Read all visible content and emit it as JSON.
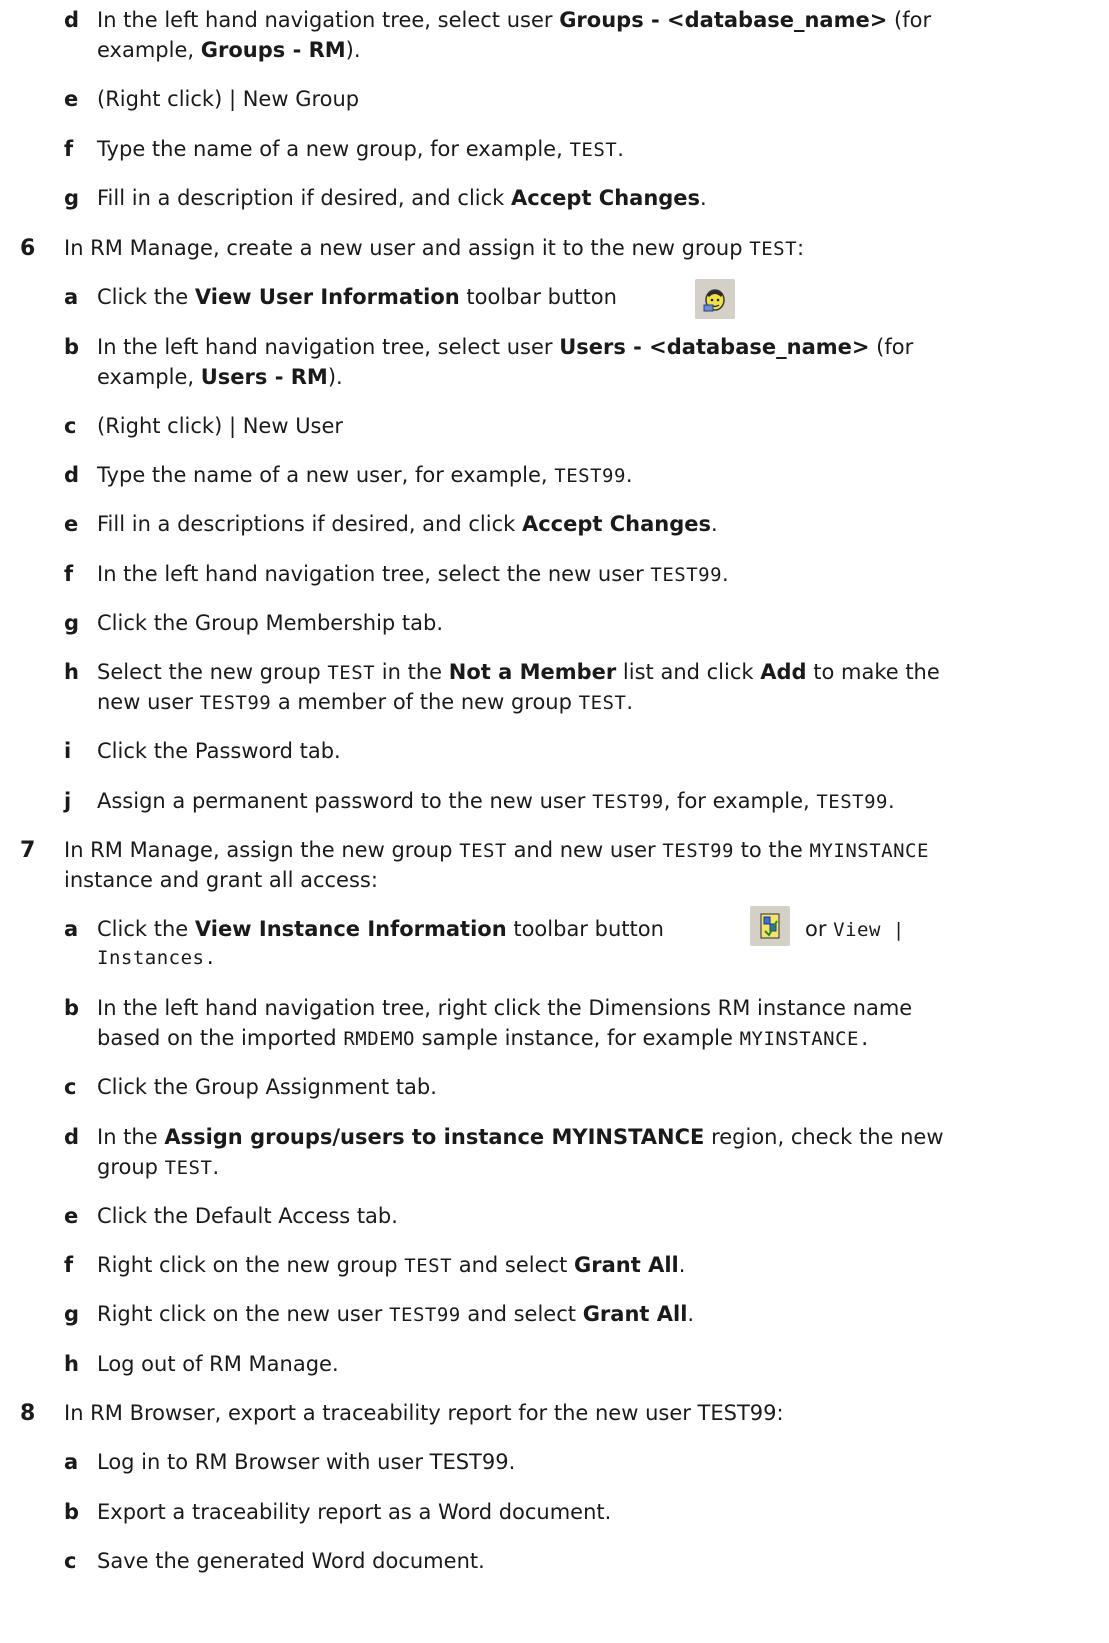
{
  "steps": {
    "s5": {
      "items": {
        "d": {
          "letter": "d",
          "l1_a": "In the left hand navigation tree, select user ",
          "l1_b": "Groups - <database_name>",
          "l1_c": " (for",
          "l2_a": "example, ",
          "l2_b": "Groups - RM",
          "l2_c": ")."
        },
        "e": {
          "letter": "e",
          "text": "(Right click) | New Group"
        },
        "f": {
          "letter": "f",
          "a": "Type the name of a new group, for example, ",
          "code": "TEST",
          "c": "."
        },
        "g": {
          "letter": "g",
          "a": "Fill in a description if desired, and click ",
          "b": "Accept Changes",
          "c": "."
        }
      }
    },
    "s6": {
      "num": "6",
      "a": "In RM Manage, create a new user and assign it to the new group ",
      "code": "TEST",
      "c": ":",
      "items": {
        "a": {
          "letter": "a",
          "t1": "Click the ",
          "b": "View User Information",
          "t2": " toolbar button"
        },
        "b": {
          "letter": "b",
          "l1_a": "In the left hand navigation tree, select user ",
          "l1_b": "Users - <database_name>",
          "l1_c": " (for",
          "l2_a": "example, ",
          "l2_b": "Users - RM",
          "l2_c": ")."
        },
        "c": {
          "letter": "c",
          "text": "(Right click) | New User"
        },
        "d": {
          "letter": "d",
          "a": "Type the name of a new user, for example, ",
          "code": "TEST99",
          "c": "."
        },
        "e": {
          "letter": "e",
          "a": "Fill in a descriptions if desired, and click ",
          "b": "Accept Changes",
          "c": "."
        },
        "f": {
          "letter": "f",
          "a": "In the left hand navigation tree, select the new user ",
          "code": "TEST99",
          "c": "."
        },
        "g": {
          "letter": "g",
          "text": "Click the Group Membership tab."
        },
        "h": {
          "letter": "h",
          "l1_a": "Select the new group ",
          "l1_code": "TEST",
          "l1_b": " in the ",
          "l1_bold1": "Not a Member",
          "l1_c": " list and click ",
          "l1_bold2": "Add",
          "l1_d": " to make the",
          "l2_a": "new user ",
          "l2_code1": "TEST99",
          "l2_b": " a member of the new group ",
          "l2_code2": "TEST",
          "l2_c": "."
        },
        "i": {
          "letter": "i",
          "text": "Click the Password tab."
        },
        "j": {
          "letter": "j",
          "a": "Assign a permanent password to the new user ",
          "code1": "TEST99",
          "b": ", for example, ",
          "code2": "TEST99",
          "c": "."
        }
      }
    },
    "s7": {
      "num": "7",
      "l1_a": "In RM Manage, assign the new group ",
      "l1_code1": "TEST",
      "l1_b": " and new user ",
      "l1_code2": "TEST99",
      "l1_c": " to the ",
      "l1_code3": "MYINSTANCE",
      "l2": "instance and grant all access:",
      "items": {
        "a": {
          "letter": "a",
          "t1": "Click the ",
          "b": "View Instance Information",
          "t2": " toolbar button",
          "t3": "or ",
          "code1": "View |",
          "code2": "Instances."
        },
        "b": {
          "letter": "b",
          "l1": "In the left hand navigation tree, right click the Dimensions RM instance name",
          "l2_a": "based on the imported ",
          "l2_code1": "RMDEMO",
          "l2_b": " sample instance, for example ",
          "l2_code2": "MYINSTANCE."
        },
        "c": {
          "letter": "c",
          "text": "Click the Group Assignment tab."
        },
        "d": {
          "letter": "d",
          "l1_a": "In the ",
          "l1_b": "Assign groups/users to instance MYINSTANCE",
          "l1_c": " region, check the new",
          "l2_a": "group ",
          "l2_code": "TEST",
          "l2_c": "."
        },
        "e": {
          "letter": "e",
          "text": "Click the Default Access tab."
        },
        "f": {
          "letter": "f",
          "a": "Right click on the new group ",
          "code": "TEST",
          "b": " and select ",
          "bold": "Grant All",
          "c": "."
        },
        "g": {
          "letter": "g",
          "a": "Right click on the new user ",
          "code": "TEST99",
          "b": " and select ",
          "bold": "Grant All",
          "c": "."
        },
        "h": {
          "letter": "h",
          "text": "Log out of RM Manage."
        }
      }
    },
    "s8": {
      "num": "8",
      "text": "In RM Browser, export a traceability report for the new user TEST99:",
      "items": {
        "a": {
          "letter": "a",
          "text": "Log in to RM Browser with user TEST99."
        },
        "b": {
          "letter": "b",
          "text": "Export a traceability report as a Word document."
        },
        "c": {
          "letter": "c",
          "text": "Save the generated Word document."
        }
      }
    }
  },
  "icons": {
    "user_info": "view-user-information-icon",
    "instance_info": "view-instance-information-icon"
  }
}
